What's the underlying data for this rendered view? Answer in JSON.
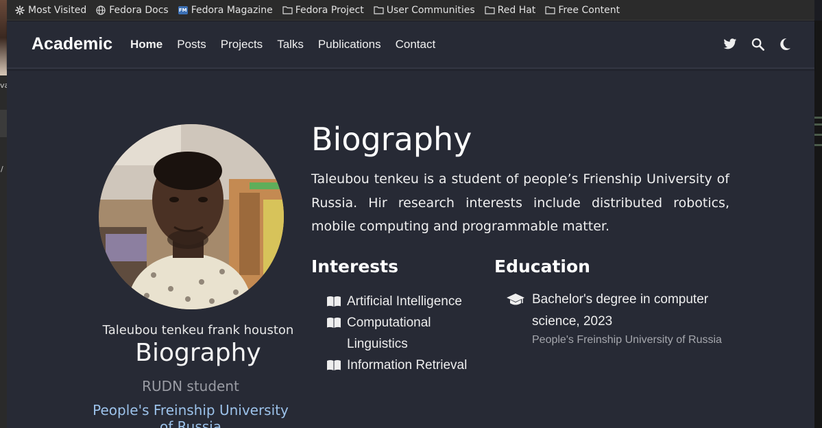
{
  "bookmarks": [
    {
      "label": "Most Visited",
      "icon": "gear-icon"
    },
    {
      "label": "Fedora Docs",
      "icon": "globe-icon"
    },
    {
      "label": "Fedora Magazine",
      "icon": "fm-icon"
    },
    {
      "label": "Fedora Project",
      "icon": "folder-icon"
    },
    {
      "label": "User Communities",
      "icon": "folder-icon"
    },
    {
      "label": "Red Hat",
      "icon": "folder-icon"
    },
    {
      "label": "Free Content",
      "icon": "folder-icon"
    }
  ],
  "left_strip": {
    "t1": "va",
    "t2": "/"
  },
  "navbar": {
    "brand": "Academic",
    "links": [
      "Home",
      "Posts",
      "Projects",
      "Talks",
      "Publications",
      "Contact"
    ],
    "active": "Home",
    "icons": [
      "twitter-icon",
      "search-icon",
      "moon-icon"
    ]
  },
  "profile": {
    "name": "Taleubou tenkeu frank houston",
    "title": "Biography",
    "role": "RUDN student",
    "organization": "People's Freinship University of Russia"
  },
  "biography": {
    "heading": "Biography",
    "text": "Taleubou tenkeu is a student of people’s Frienship University of Russia. Hir research interests include distributed robotics, mobile computing and programmable matter."
  },
  "interests": {
    "heading": "Interests",
    "items": [
      "Artificial Intelligence",
      "Computational Linguistics",
      "Information Retrieval"
    ]
  },
  "education": {
    "heading": "Education",
    "items": [
      {
        "course": "Bachelor's degree in computer science, 2023",
        "institution": "People's Freinship University of Russia"
      }
    ]
  },
  "colors": {
    "background": "#272a35",
    "accent_link": "#9cc2ea",
    "bookmarks_bar": "#2b2b2b"
  }
}
